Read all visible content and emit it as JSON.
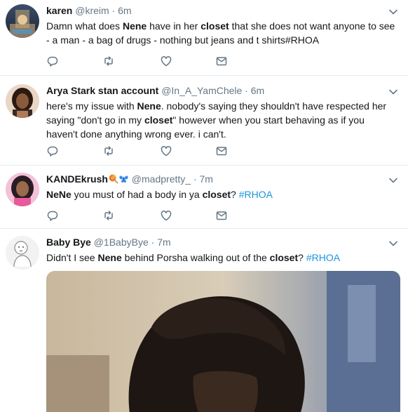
{
  "tweets": [
    {
      "name": "karen",
      "handle": "@kreim",
      "sep": "·",
      "time": "6m",
      "segments": [
        {
          "t": "Damn what does "
        },
        {
          "t": "Nene",
          "b": true
        },
        {
          "t": " have in her "
        },
        {
          "t": "closet",
          "b": true
        },
        {
          "t": " that she does not want anyone to see - a man - a bag of drugs - nothing but jeans and t shirts#RHOA"
        }
      ]
    },
    {
      "name": "Arya Stark stan account",
      "handle": "@In_A_YamChele",
      "sep": "·",
      "time": "6m",
      "segments": [
        {
          "t": "here's my issue with "
        },
        {
          "t": "Nene",
          "b": true
        },
        {
          "t": ". nobody's saying they shouldn't have respected her saying \"don't go in my "
        },
        {
          "t": "closet",
          "b": true
        },
        {
          "t": "\" however when you start behaving as if you haven't done anything wrong ever. i can't."
        }
      ]
    },
    {
      "name": "KANDEkrush",
      "handle": "@madpretty_",
      "sep": "·",
      "time": "7m",
      "segments": [
        {
          "t": "NeNe",
          "b": true
        },
        {
          "t": " you must of had a body in ya "
        },
        {
          "t": "closet",
          "b": true
        },
        {
          "t": "? "
        },
        {
          "t": "#RHOA",
          "h": true
        }
      ]
    },
    {
      "name": "Baby Bye",
      "handle": "@1BabyBye",
      "sep": "·",
      "time": "7m",
      "segments": [
        {
          "t": "Didn't I see "
        },
        {
          "t": "Nene",
          "b": true
        },
        {
          "t": " behind Porsha walking out of the "
        },
        {
          "t": "closet",
          "b": true
        },
        {
          "t": "? "
        },
        {
          "t": "#RHOA",
          "h": true
        }
      ]
    }
  ],
  "icons": {
    "reply": "reply-icon",
    "retweet": "retweet-icon",
    "like": "heart-icon",
    "message": "message-icon",
    "caret": "chevron-down-icon"
  },
  "colors": {
    "text": "#14171a",
    "secondary": "#657786",
    "link": "#1b95e0",
    "divider": "#e6ecf0",
    "emoji_lollipop": "#f4a742",
    "emoji_butterfly": "#3a8ee6"
  }
}
